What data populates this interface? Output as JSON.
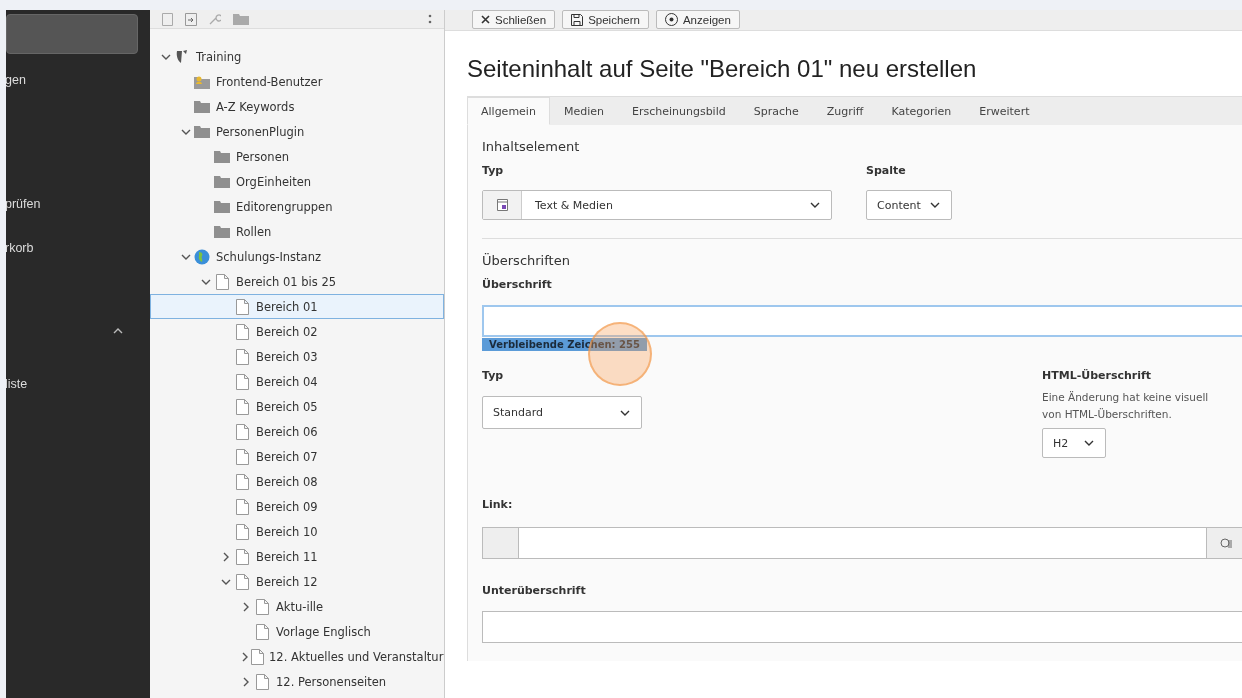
{
  "modules": {
    "items": [
      {
        "label": "gen"
      },
      {
        "label": "prüfen"
      },
      {
        "label": "rkorb"
      },
      {
        "label": "liste"
      }
    ]
  },
  "tree": {
    "items": [
      {
        "label": "Training",
        "kind": "site",
        "expanded": true,
        "selected": false,
        "children": [
          {
            "label": "Frontend-Benutzer",
            "kind": "user-folder",
            "selected": false
          },
          {
            "label": "A-Z Keywords",
            "kind": "folder",
            "selected": false
          },
          {
            "label": "PersonenPlugin",
            "kind": "folder",
            "expanded": true,
            "selected": false,
            "children": [
              {
                "label": "Personen",
                "kind": "folder",
                "selected": false
              },
              {
                "label": "OrgEinheiten",
                "kind": "folder",
                "selected": false
              },
              {
                "label": "Editorengruppen",
                "kind": "folder",
                "selected": false
              },
              {
                "label": "Rollen",
                "kind": "folder",
                "selected": false
              }
            ]
          },
          {
            "label": "Schulungs-Instanz",
            "kind": "globe",
            "expanded": true,
            "selected": false,
            "children": [
              {
                "label": "Bereich 01 bis 25",
                "kind": "page",
                "expanded": true,
                "selected": false,
                "children": [
                  {
                    "label": "Bereich 01",
                    "kind": "page",
                    "selected": true
                  },
                  {
                    "label": "Bereich 02",
                    "kind": "page",
                    "selected": false
                  },
                  {
                    "label": "Bereich 03",
                    "kind": "page",
                    "selected": false
                  },
                  {
                    "label": "Bereich 04",
                    "kind": "page",
                    "selected": false
                  },
                  {
                    "label": "Bereich 05",
                    "kind": "page",
                    "selected": false
                  },
                  {
                    "label": "Bereich 06",
                    "kind": "page",
                    "selected": false
                  },
                  {
                    "label": "Bereich 07",
                    "kind": "page",
                    "selected": false
                  },
                  {
                    "label": "Bereich 08",
                    "kind": "page",
                    "selected": false
                  },
                  {
                    "label": "Bereich 09",
                    "kind": "page",
                    "selected": false
                  },
                  {
                    "label": "Bereich 10",
                    "kind": "page",
                    "selected": false
                  },
                  {
                    "label": "Bereich 11",
                    "kind": "page",
                    "expanded": false,
                    "selected": false
                  },
                  {
                    "label": "Bereich 12",
                    "kind": "page",
                    "expanded": true,
                    "selected": false,
                    "children": [
                      {
                        "label": "Aktu-ille",
                        "kind": "page",
                        "expanded": false,
                        "selected": false
                      },
                      {
                        "label": "Vorlage Englisch",
                        "kind": "page",
                        "selected": false
                      },
                      {
                        "label": "12. Aktuelles und Veranstaltur",
                        "kind": "page",
                        "expanded": false,
                        "selected": false
                      },
                      {
                        "label": "12. Personenseiten",
                        "kind": "page",
                        "expanded": false,
                        "selected": false
                      }
                    ]
                  }
                ]
              }
            ]
          }
        ]
      }
    ]
  },
  "toolbar": {
    "buttons": [
      {
        "label": "Schließen",
        "kind": "close"
      },
      {
        "label": "Speichern",
        "kind": "save"
      },
      {
        "label": "Anzeigen",
        "kind": "view"
      }
    ]
  },
  "title": "Seiteninhalt auf Seite \"Bereich 01\" neu erstellen",
  "tabs": [
    {
      "label": "Allgemein",
      "selected": true
    },
    {
      "label": "Medien",
      "selected": false
    },
    {
      "label": "Erscheinungsbild",
      "selected": false
    },
    {
      "label": "Sprache",
      "selected": false
    },
    {
      "label": "Zugriff",
      "selected": false
    },
    {
      "label": "Kategorien",
      "selected": false
    },
    {
      "label": "Erweitert",
      "selected": false
    }
  ],
  "content_element": {
    "heading": "Inhaltselement",
    "type": {
      "label": "Typ",
      "value": "Text & Medien"
    },
    "column": {
      "label": "Spalte",
      "value": "Content"
    }
  },
  "headlines": {
    "heading": "Überschriften",
    "header": {
      "label": "Überschrift",
      "focused": true,
      "click_marker": true,
      "counter": "Verbleibende Zeichen: 255"
    },
    "type": {
      "label": "Typ",
      "value": "Standard"
    },
    "html_header": {
      "label": "HTML-Überschrift",
      "description_lines": [
        "Eine Änderung hat keine visuell",
        "von HTML-Überschriften."
      ],
      "value": "H2"
    },
    "link": {
      "label": "Link:"
    },
    "subheader": {
      "label": "Unterüberschrift"
    }
  }
}
